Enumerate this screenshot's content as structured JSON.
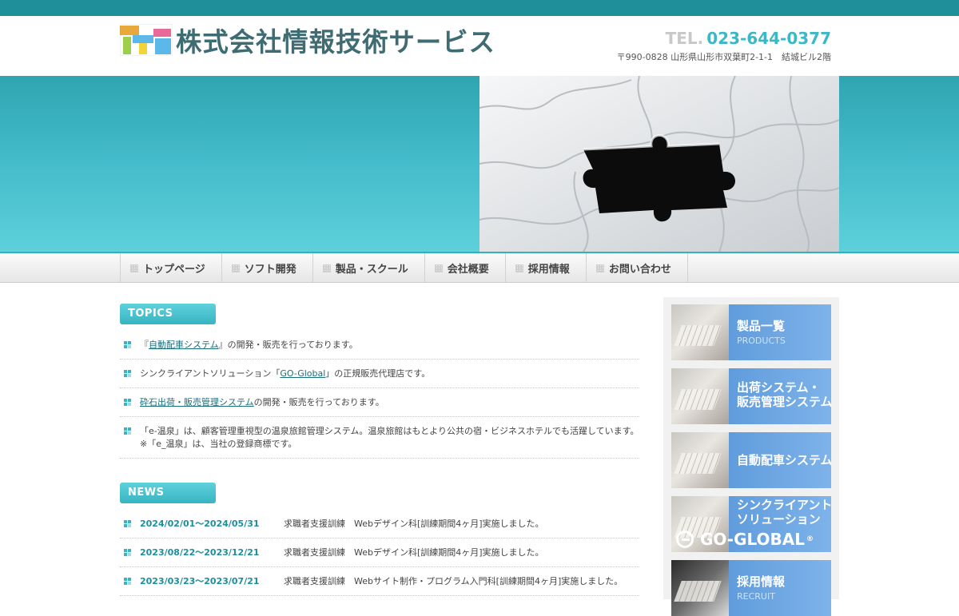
{
  "header": {
    "logo_letters": "ITS",
    "company_name": "株式会社情報技術サービス",
    "tel_label": "TEL.",
    "tel_number": "023-644-0377",
    "address": "〒990-0828 山形県山形市双葉町2-1-1　結城ビル2階"
  },
  "nav": {
    "items": [
      {
        "label": "トップページ"
      },
      {
        "label": "ソフト開発"
      },
      {
        "label": "製品・スクール"
      },
      {
        "label": "会社概要"
      },
      {
        "label": "採用情報"
      },
      {
        "label": "お問い合わせ"
      }
    ]
  },
  "topics": {
    "heading": "TOPICS",
    "items": [
      {
        "pre": "『",
        "link": "自動配車システム",
        "post": "』の開発・販売を行っております。"
      },
      {
        "pre": "シンクライアントソリューション「",
        "link": "GO-Global",
        "post": "」の正規販売代理店です。"
      },
      {
        "pre": "",
        "link": "砕石出荷・販売管理システム",
        "post": "の開発・販売を行っております。"
      },
      {
        "pre": "「e-温泉」は、顧客管理重視型の温泉旅館管理システム。温泉旅館はもとより公共の宿・ビジネスホテルでも活躍しています。※「e_温泉」は、当社の登録商標です。",
        "link": "",
        "post": ""
      }
    ]
  },
  "news": {
    "heading": "NEWS",
    "items": [
      {
        "date": "2024/02/01～2024/05/31",
        "text": "求職者支援訓練　Webデザイン科[訓練期間4ヶ月]実施しました。"
      },
      {
        "date": "2023/08/22～2023/12/21",
        "text": "求職者支援訓練　Webデザイン科[訓練期間4ヶ月]実施しました。"
      },
      {
        "date": "2023/03/23～2023/07/21",
        "text": "求職者支援訓練　Webサイト制作・プログラム入門科[訓練期間4ヶ月]実施しました。"
      }
    ]
  },
  "sidebar": {
    "banners": [
      {
        "title": "製品一覧",
        "sub": "PRODUCTS"
      },
      {
        "title": "出荷システム・販売管理システム",
        "line1": "出荷システム・",
        "line2": "販売管理システム"
      },
      {
        "title": "自動配車システム"
      },
      {
        "line1": "シンクライアント",
        "line2": "ソリューション",
        "brand": "GO-GLOBAL",
        "reg": "®"
      },
      {
        "title": "採用情報",
        "sub": "RECRUIT"
      }
    ]
  }
}
